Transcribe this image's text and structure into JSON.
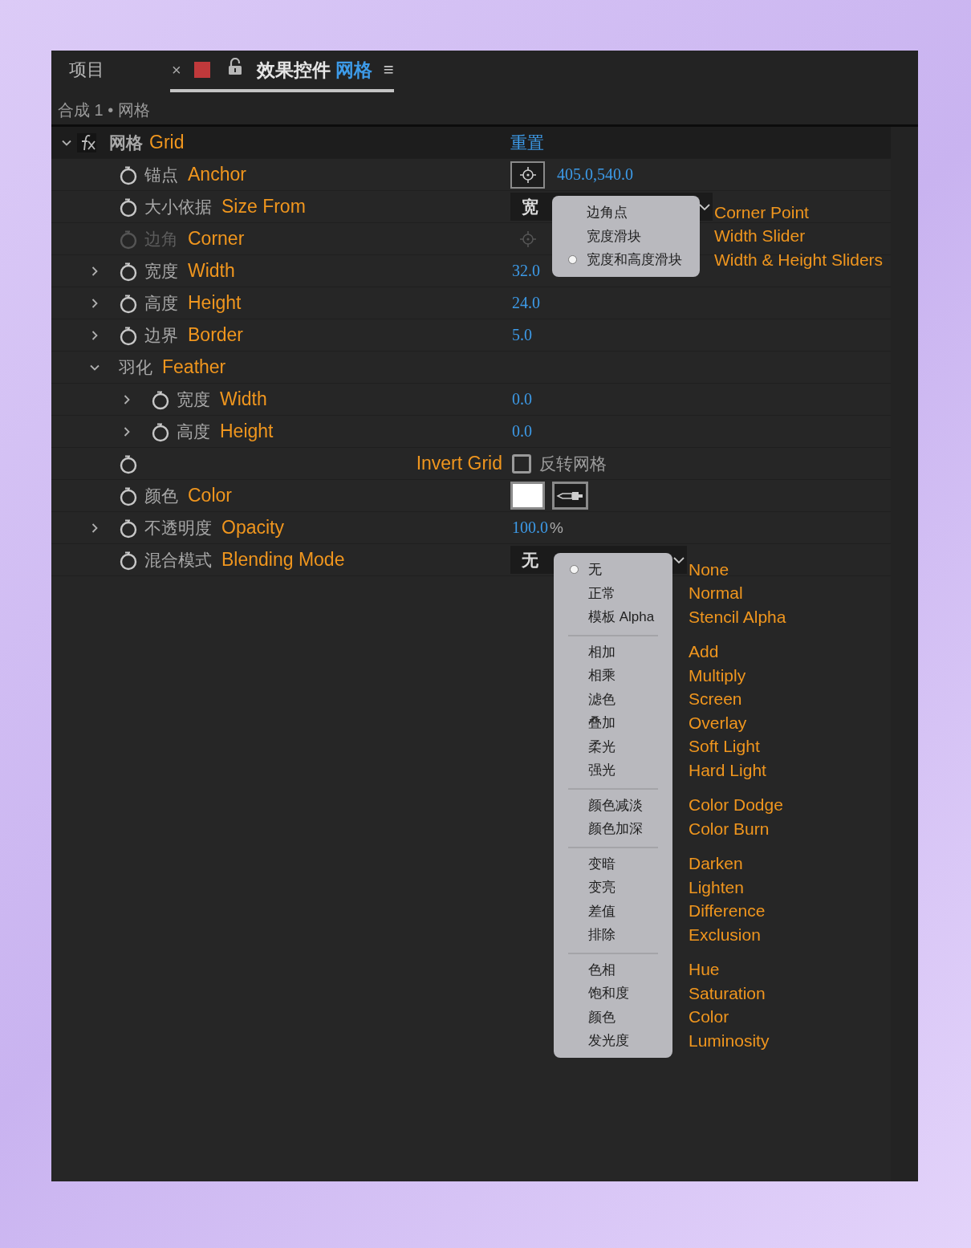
{
  "tabs": [
    {
      "label": "项目",
      "selected": false
    },
    {
      "label": "效果控件",
      "layer": "网格",
      "close": "×",
      "menu": "≡",
      "color": "#c0393b",
      "locked": false,
      "selected": true
    }
  ],
  "breadcrumb": "合成 1 • 网格",
  "effect": {
    "label": "网格",
    "annotation": "Grid",
    "expanded": true,
    "reset": "重置"
  },
  "properties": [
    {
      "kind": "point",
      "label": "锚点",
      "annotation": "Anchor",
      "value": "405.0,540.0"
    },
    {
      "kind": "dropdown",
      "label": "大小依据",
      "annotation": "Size From",
      "value": "宽",
      "menu": [
        [
          {
            "label": "边角点",
            "annotation": "Corner Point",
            "selected": false
          },
          {
            "label": "宽度滑块",
            "annotation": "Width Slider",
            "selected": false
          },
          {
            "label": "宽度和高度滑块",
            "annotation": "Width & Height Sliders",
            "selected": true
          }
        ]
      ]
    },
    {
      "kind": "point",
      "label": "边角",
      "annotation": "Corner",
      "disabled": true
    },
    {
      "kind": "number",
      "label": "宽度",
      "annotation": "Width",
      "value": "32.0",
      "expanded": false
    },
    {
      "kind": "number",
      "label": "高度",
      "annotation": "Height",
      "value": "24.0",
      "expanded": false
    },
    {
      "kind": "number",
      "label": "边界",
      "annotation": "Border",
      "value": "5.0",
      "expanded": false
    },
    {
      "kind": "group",
      "label": "羽化",
      "annotation": "Feather",
      "expanded": true,
      "children": [
        {
          "kind": "number",
          "label": "宽度",
          "annotation": "Width",
          "value": "0.0",
          "expanded": false
        },
        {
          "kind": "number",
          "label": "高度",
          "annotation": "Height",
          "value": "0.0",
          "expanded": false
        }
      ]
    },
    {
      "kind": "checkbox",
      "annotation": "Invert Grid",
      "label": "反转网格",
      "checked": false
    },
    {
      "kind": "color",
      "label": "颜色",
      "annotation": "Color",
      "color": "#ffffff"
    },
    {
      "kind": "number",
      "label": "不透明度",
      "annotation": "Opacity",
      "value": "100.0",
      "unit": "%",
      "expanded": false
    },
    {
      "kind": "dropdown",
      "label": "混合模式",
      "annotation": "Blending Mode",
      "value": "无",
      "menu": [
        [
          {
            "label": "无",
            "annotation": "None",
            "selected": true
          },
          {
            "label": "正常",
            "annotation": "Normal",
            "selected": false
          },
          {
            "label": "模板 Alpha",
            "annotation": "Stencil Alpha",
            "selected": false
          }
        ],
        [
          {
            "label": "相加",
            "annotation": "Add",
            "selected": false
          },
          {
            "label": "相乘",
            "annotation": "Multiply",
            "selected": false
          },
          {
            "label": "滤色",
            "annotation": "Screen",
            "selected": false
          },
          {
            "label": "叠加",
            "annotation": "Overlay",
            "selected": false
          },
          {
            "label": "柔光",
            "annotation": "Soft Light",
            "selected": false
          },
          {
            "label": "强光",
            "annotation": "Hard Light",
            "selected": false
          }
        ],
        [
          {
            "label": "颜色减淡",
            "annotation": "Color Dodge",
            "selected": false
          },
          {
            "label": "颜色加深",
            "annotation": "Color Burn",
            "selected": false
          }
        ],
        [
          {
            "label": "变暗",
            "annotation": "Darken",
            "selected": false
          },
          {
            "label": "变亮",
            "annotation": "Lighten",
            "selected": false
          },
          {
            "label": "差值",
            "annotation": "Difference",
            "selected": false
          },
          {
            "label": "排除",
            "annotation": "Exclusion",
            "selected": false
          }
        ],
        [
          {
            "label": "色相",
            "annotation": "Hue",
            "selected": false
          },
          {
            "label": "饱和度",
            "annotation": "Saturation",
            "selected": false
          },
          {
            "label": "颜色",
            "annotation": "Color",
            "selected": false
          },
          {
            "label": "发光度",
            "annotation": "Luminosity",
            "selected": false
          }
        ]
      ]
    }
  ]
}
